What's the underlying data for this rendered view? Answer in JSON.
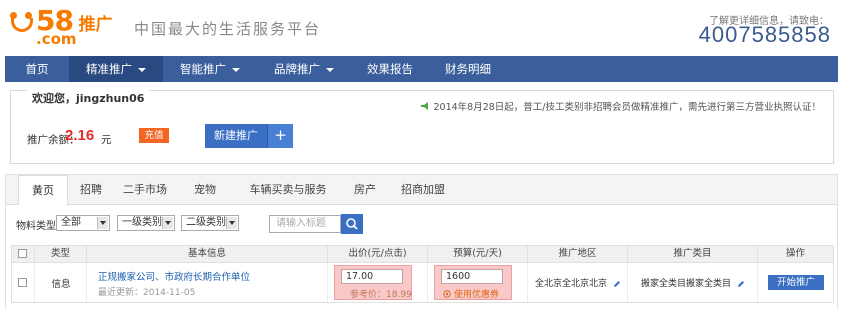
{
  "brand": {
    "logo_number": "58",
    "logo_domain": ".com",
    "logo_suffix": "推广",
    "slogan": "中国最大的生活服务平台"
  },
  "hotline": {
    "label": "了解更详细信息，请致电：",
    "number": "4007585858"
  },
  "nav": {
    "items": [
      {
        "label": "首页",
        "dropdown": false
      },
      {
        "label": "精准推广",
        "dropdown": true,
        "active": true
      },
      {
        "label": "智能推广",
        "dropdown": true
      },
      {
        "label": "品牌推广",
        "dropdown": true
      },
      {
        "label": "效果报告",
        "dropdown": false
      },
      {
        "label": "财务明细",
        "dropdown": false
      }
    ]
  },
  "welcome": {
    "greeting": "欢迎您，jingzhun06",
    "notice": "2014年8月28日起，普工/技工类别非招聘会员做精准推广，需先进行第三方营业执照认证！",
    "balance_label": "推广余额：",
    "balance_value": "2.16",
    "balance_unit": "元",
    "recharge_label": "充值",
    "new_promo_label": "新建推广",
    "new_promo_plus": "+"
  },
  "tabs": [
    "黄页",
    "招聘",
    "二手市场",
    "宠物",
    "车辆买卖与服务",
    "房产",
    "招商加盟"
  ],
  "filters": {
    "label": "物料类型",
    "select_all": "全部",
    "select_level1": "一级类别",
    "select_level2": "二级类别",
    "search_placeholder": "请输入标题"
  },
  "table": {
    "headers": [
      "类型",
      "基本信息",
      "出价(元/点击)",
      "预算(元/天)",
      "推广地区",
      "推广类目",
      "操作"
    ],
    "rows": [
      {
        "type": "信息",
        "title": "正规搬家公司、市政府长期合作单位",
        "updated": "最近更新：2014-11-05",
        "bid": "17.00",
        "reference": "参考价：18.99",
        "budget": "1600",
        "coupon": "使用优惠券",
        "region": "全北京全北京北京",
        "category": "搬家全类目搬家全类目",
        "action": "开始推广"
      }
    ]
  },
  "colors": {
    "nav": "#3a5f9c",
    "accent_orange": "#f77b00",
    "price_red": "#e52b2b",
    "button_blue": "#3a6fc4",
    "highlight": "#f9c8c8"
  }
}
